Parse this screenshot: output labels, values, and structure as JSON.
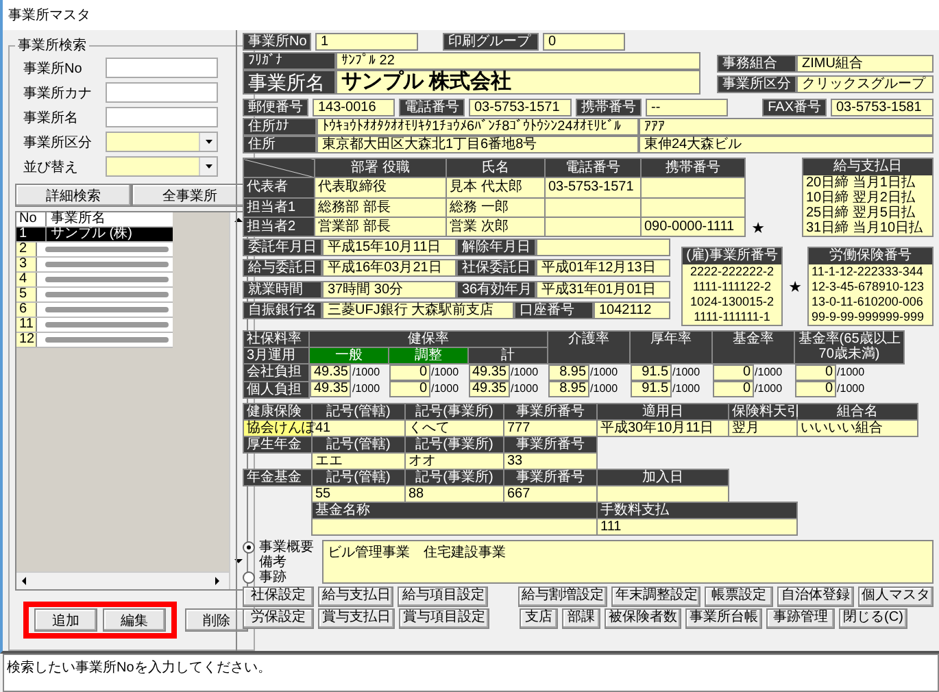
{
  "window": {
    "title": "事業所マスタ"
  },
  "search": {
    "legend": "事業所検索",
    "fields": [
      {
        "label": "事業所No",
        "kind": "text"
      },
      {
        "label": "事業所カナ",
        "kind": "text"
      },
      {
        "label": "事業所名",
        "kind": "text"
      },
      {
        "label": "事業所区分",
        "kind": "select"
      },
      {
        "label": "並び替え",
        "kind": "select"
      }
    ],
    "buttons": [
      "詳細検索",
      "全事業所"
    ],
    "list": {
      "columns": [
        "No",
        "事業所名"
      ],
      "rows": [
        {
          "no": "1",
          "name": "サンプル (株)",
          "selected": true,
          "redacted": false
        },
        {
          "no": "2",
          "selected": false,
          "redacted": true
        },
        {
          "no": "3",
          "selected": false,
          "redacted": true
        },
        {
          "no": "4",
          "selected": false,
          "redacted": true
        },
        {
          "no": "5",
          "selected": false,
          "redacted": true
        },
        {
          "no": "6",
          "selected": false,
          "redacted": true
        },
        {
          "no": "11",
          "selected": false,
          "redacted": true
        },
        {
          "no": "12",
          "selected": false,
          "redacted": true
        }
      ]
    },
    "actions": [
      {
        "label": "追加",
        "highlighted": true
      },
      {
        "label": "編集",
        "highlighted": true
      },
      {
        "label": "削除",
        "highlighted": false
      }
    ]
  },
  "office": {
    "fields": [
      {
        "label": "事業所No",
        "value": "1"
      },
      {
        "label": "印刷グループ",
        "value": "0"
      }
    ],
    "furigana": {
      "label": "ﾌﾘｶﾞﾅ",
      "value": "ｻﾝﾌﾟﾙ 22"
    },
    "name": {
      "label": "事業所名",
      "value": "サンプル 株式会社"
    },
    "side": [
      {
        "label": "事務組合",
        "value": "ZIMU組合"
      },
      {
        "label": "事業所区分",
        "value": "クリックスグループ"
      }
    ],
    "contact": [
      {
        "label": "郵便番号",
        "value": "143-0016"
      },
      {
        "label": "電話番号",
        "value": "03-5753-1571"
      },
      {
        "label": "携帯番号",
        "value": "--"
      },
      {
        "label": "FAX番号",
        "value": "03-5753-1581"
      }
    ],
    "address": [
      {
        "label": "住所ｶﾅ",
        "values": [
          "ﾄｳｷｮｳﾄｵｵﾀｸｵｵﾓﾘｷﾀ1ﾁｮｳﾒ6ﾊﾞﾝﾁ8ｺﾞｳﾄｳｼﾝ24ｵｵﾓﾘﾋﾞﾙ",
          "ｱｱｱ"
        ]
      },
      {
        "label": "住所",
        "values": [
          "東京都大田区大森北1丁目6番地8号",
          "東伸24大森ビル"
        ]
      }
    ]
  },
  "people": {
    "columns": [
      "部署 役職",
      "氏名",
      "電話番号",
      "携帯番号"
    ],
    "rows": [
      {
        "role": "代表者",
        "cells": [
          "代表取締役",
          "見本 代太郎",
          "03-5753-1571",
          null
        ]
      },
      {
        "role": "担当者1",
        "cells": [
          "総務部 部長",
          "総務 一郎",
          null,
          null
        ]
      },
      {
        "role": "担当者2",
        "cells": [
          "営業部 部長",
          "営業 次郎",
          null,
          "090-0000-1111"
        ]
      }
    ],
    "star": "★"
  },
  "payday": {
    "title": "給与支払日",
    "lines": [
      "20日締 当月1日払",
      "10日締 翌月2日払",
      "25日締 翌月5日払",
      "31日締 当月10日払"
    ]
  },
  "dates": [
    [
      {
        "label": "委託年月日",
        "value": "平成15年10月11日"
      },
      {
        "label": "解除年月日"
      }
    ],
    [
      {
        "label": "給与委託日",
        "value": "平成16年03月21日"
      },
      {
        "label": "社保委託日",
        "value": "平成01年12月13日"
      }
    ],
    [
      {
        "label": "就業時間",
        "value": "37時間 30分"
      },
      {
        "label": "36有効年月",
        "value": "平成31年01月01日"
      }
    ],
    [
      {
        "label": "自振銀行名",
        "value": "三菱UFJ銀行 大森駅前支店"
      },
      {
        "label": "口座番号",
        "value": "1042112"
      }
    ]
  ],
  "employment_numbers": {
    "title": "(雇)事業所番号",
    "lines": [
      "2222-222222-2",
      "1111-111122-2",
      "1024-130015-2",
      "1111-111111-1"
    ]
  },
  "labor_star": "★",
  "labor_numbers": {
    "title": "労働保険番号",
    "lines": [
      "11-1-12-222333-344",
      "12-3-45-678910-123",
      "13-0-11-610200-006",
      "99-9-99-999999-999"
    ]
  },
  "rates": {
    "corner": "社保料率",
    "period": "3月運用",
    "group": "健保率",
    "columns": [
      {
        "label": "一般",
        "highlighted": true
      },
      {
        "label": "調整",
        "highlighted": true
      },
      {
        "label": "計",
        "highlighted": false
      },
      {
        "label": "介護率",
        "highlighted": false
      },
      {
        "label": "厚年率",
        "highlighted": false
      },
      {
        "label": "基金率",
        "highlighted": false
      },
      {
        "label": "基金率(65歳以上70歳未満)",
        "highlighted": false
      }
    ],
    "rows": [
      {
        "label": "会社負担",
        "cells": [
          {
            "value": "49.35",
            "unit": "/1000"
          },
          {
            "value": "0",
            "unit": "/1000"
          },
          {
            "value": "49.35",
            "unit": "/1000"
          },
          {
            "value": "8.95",
            "unit": "/1000"
          },
          {
            "value": "91.5",
            "unit": "/1000"
          },
          {
            "value": "0",
            "unit": "/1000"
          },
          {
            "value": "0",
            "unit": "/1000"
          }
        ]
      },
      {
        "label": "個人負担",
        "cells": [
          {
            "value": "49.35",
            "unit": "/1000"
          },
          {
            "value": "0",
            "unit": "/1000"
          },
          {
            "value": "49.35",
            "unit": "/1000"
          },
          {
            "value": "8.95",
            "unit": "/1000"
          },
          {
            "value": "91.5",
            "unit": "/1000"
          },
          {
            "value": "0",
            "unit": "/1000"
          },
          {
            "value": "0",
            "unit": "/1000"
          }
        ]
      }
    ]
  },
  "insurance": {
    "health": {
      "label": "健康保険",
      "headers": [
        "記号(管轄)",
        "記号(事業所)",
        "事業所番号",
        "適用日",
        "保険料天引",
        "組合名"
      ],
      "type": "協会けんぽ",
      "values": [
        "41",
        "くへて",
        "777",
        "平成30年10月11日",
        "翌月",
        "いいいい組合"
      ]
    },
    "pension": {
      "label": "厚生年金",
      "headers": [
        "記号(管轄)",
        "記号(事業所)",
        "事業所番号"
      ],
      "values": [
        "エエ",
        "オオ",
        "33"
      ]
    },
    "fund": {
      "label": "年金基金",
      "headers": [
        "記号(管轄)",
        "記号(事業所)",
        "事業所番号",
        "加入日"
      ],
      "values": [
        "55",
        "88",
        "667"
      ],
      "name_header": "基金名称",
      "fee_header": "手数料支払",
      "fee_value": "111"
    }
  },
  "notes": {
    "options": [
      {
        "label": "事業概要備考",
        "selected": true
      },
      {
        "label": "事跡",
        "selected": false
      }
    ],
    "text": "ビル管理事業　住宅建設事業"
  },
  "button_rows": [
    {
      "left": [
        "社保設定",
        "給与支払日",
        "給与項目設定"
      ],
      "right": [
        "給与割増設定",
        "年末調整設定",
        "帳票設定",
        "自治体登録",
        "個人マスタ"
      ]
    },
    {
      "left": [
        "労保設定",
        "賞与支払日",
        "賞与項目設定"
      ],
      "right": [
        "支店",
        "部課",
        "被保険者数",
        "事業所台帳",
        "事跡管理",
        "閉じる(C)"
      ]
    }
  ],
  "status": "検索したい事業所Noを入力してください。"
}
